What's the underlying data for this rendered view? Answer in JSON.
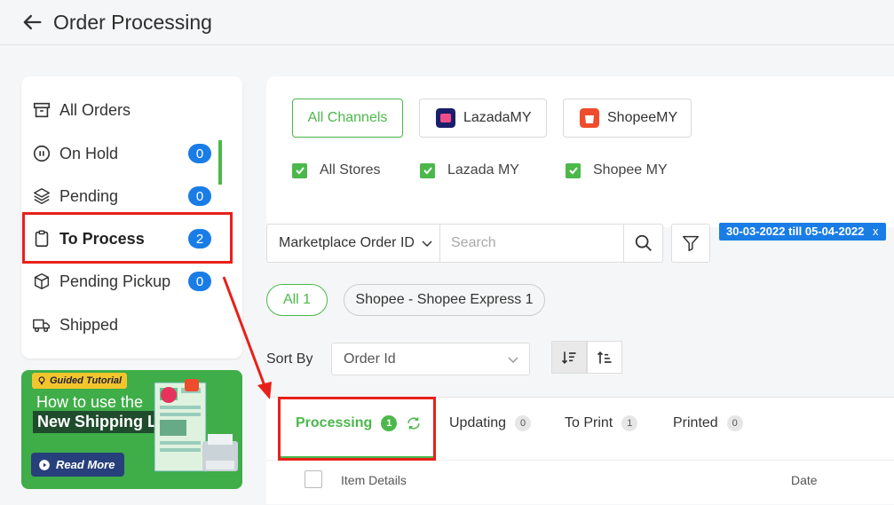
{
  "header": {
    "title": "Order Processing"
  },
  "sidebar": {
    "items": [
      {
        "label": "All Orders",
        "icon": "archive-icon",
        "count": ""
      },
      {
        "label": "On Hold",
        "icon": "pause-circle-icon",
        "count": "0"
      },
      {
        "label": "Pending",
        "icon": "layers-icon",
        "count": "0"
      },
      {
        "label": "To Process",
        "icon": "clipboard-icon",
        "count": "2"
      },
      {
        "label": "Pending Pickup",
        "icon": "box-icon",
        "count": "0"
      },
      {
        "label": "Shipped",
        "icon": "truck-icon",
        "count": ""
      }
    ]
  },
  "banner": {
    "tag": "Guided Tutorial",
    "line1": "How to use the",
    "line2": "New Shipping Label?",
    "button": "Read More"
  },
  "channels": {
    "buttons": [
      {
        "label": "All Channels"
      },
      {
        "label": "LazadaMY",
        "icon": "lazada-logo-icon"
      },
      {
        "label": "ShopeeMY",
        "icon": "shopee-logo-icon"
      }
    ],
    "stores": [
      {
        "label": "All Stores",
        "checked": true
      },
      {
        "label": "Lazada MY",
        "checked": true
      },
      {
        "label": "Shopee MY",
        "checked": true
      }
    ]
  },
  "search": {
    "field_select": "Marketplace Order ID",
    "placeholder": "Search",
    "date_filter": "30-03-2022 till 05-04-2022",
    "date_close": "x"
  },
  "shipping_pills": [
    {
      "label": "All 1"
    },
    {
      "label": "Shopee - Shopee Express 1"
    }
  ],
  "sort": {
    "label": "Sort By",
    "value": "Order Id"
  },
  "tabs": [
    {
      "label": "Processing",
      "count": "1"
    },
    {
      "label": "Updating",
      "count": "0"
    },
    {
      "label": "To Print",
      "count": "1"
    },
    {
      "label": "Printed",
      "count": "0"
    }
  ],
  "table": {
    "columns": [
      "Item Details",
      "Date"
    ]
  },
  "colors": {
    "accent_green": "#4cb84b",
    "badge_blue": "#1a7de6",
    "highlight_red": "#e8201a"
  }
}
